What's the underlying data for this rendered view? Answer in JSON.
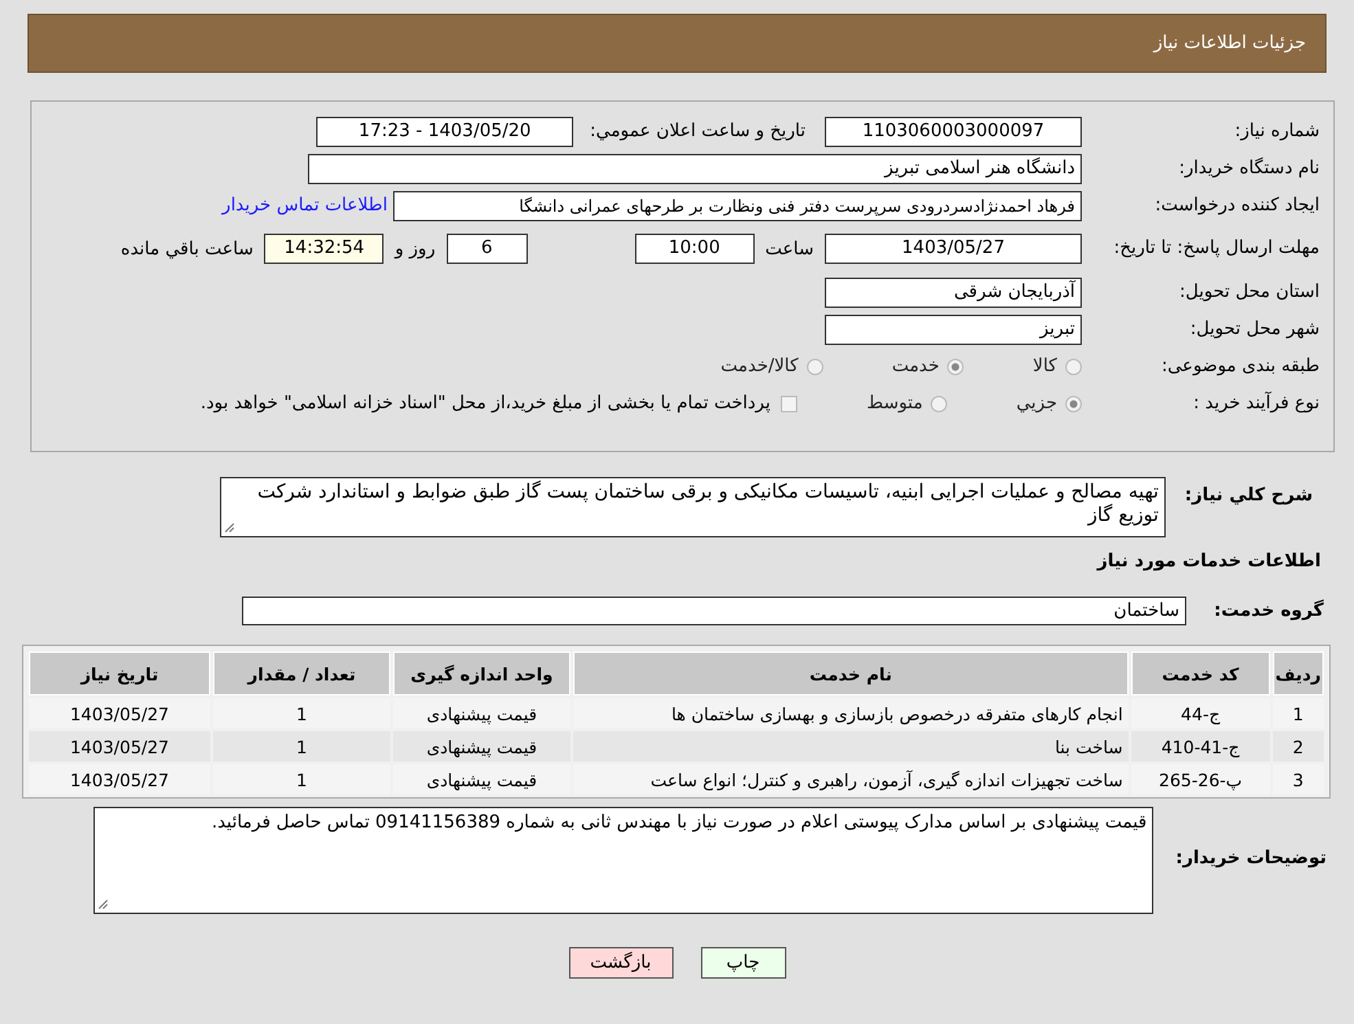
{
  "header": {
    "title": "جزئیات اطلاعات نیاز"
  },
  "need_number": {
    "label": "شماره نیاز:",
    "value": "1103060003000097"
  },
  "announce": {
    "label": "تاریخ و ساعت اعلان عمومي:",
    "value": "1403/05/20 - 17:23"
  },
  "buyer_org": {
    "label": "نام دستگاه خریدار:",
    "value": "دانشگاه هنر اسلامی تبریز"
  },
  "requester": {
    "label": "ایجاد کننده درخواست:",
    "value": "فرهاد احمدنژادسردرودی سرپرست دفتر فنی ونظارت بر طرحهای عمرانی دانشگا",
    "link": "اطلاعات تماس خریدار"
  },
  "deadline": {
    "label": "مهلت ارسال پاسخ: تا تاریخ:",
    "date": "1403/05/27",
    "time_label": "ساعت",
    "time": "10:00",
    "days": "6",
    "days_label": "روز و",
    "remaining": "14:32:54",
    "remaining_label": "ساعت باقي مانده"
  },
  "province": {
    "label": "استان محل تحویل:",
    "value": "آذربایجان شرقی"
  },
  "city": {
    "label": "شهر محل تحویل:",
    "value": "تبریز"
  },
  "category": {
    "label": "طبقه بندی موضوعی:",
    "options": [
      {
        "label": "کالا",
        "selected": false
      },
      {
        "label": "خدمت",
        "selected": true
      },
      {
        "label": "کالا/خدمت",
        "selected": false
      }
    ]
  },
  "purchase_type": {
    "label": "نوع فرآیند خرید :",
    "options": [
      {
        "label": "جزيي",
        "selected": true
      },
      {
        "label": "متوسط",
        "selected": false
      }
    ],
    "payment": {
      "label": "پرداخت تمام یا بخشی از مبلغ خرید،از محل \"اسناد خزانه اسلامی\" خواهد بود.",
      "checked": false
    }
  },
  "description": {
    "label": "شرح كلي نياز:",
    "value": "تهیه مصالح و عملیات اجرایی ابنیه، تاسیسات مکانیکی و برقی ساختمان پست گاز طبق ضوابط و استاندارد شرکت توزیع گاز"
  },
  "services_heading": "اطلاعات خدمات مورد نیاز",
  "service_group": {
    "label": "گروه خدمت:",
    "value": "ساختمان"
  },
  "table": {
    "columns": [
      "ردیف",
      "کد خدمت",
      "نام خدمت",
      "واحد اندازه گیری",
      "تعداد / مقدار",
      "تاریخ نیاز"
    ],
    "rows": [
      [
        "1",
        "ج-44",
        "انجام کارهای متفرقه درخصوص بازسازی و بهسازی ساختمان ها",
        "قیمت پیشنهادی",
        "1",
        "1403/05/27"
      ],
      [
        "2",
        "ج-41-410",
        "ساخت بنا",
        "قیمت پیشنهادی",
        "1",
        "1403/05/27"
      ],
      [
        "3",
        "پ-26-265",
        "ساخت تجهیزات اندازه گیری، آزمون، راهبری و کنترل؛ انواع ساعت",
        "قیمت پیشنهادی",
        "1",
        "1403/05/27"
      ]
    ]
  },
  "buyer_notes": {
    "label": "توضیحات خریدار:",
    "value": "قیمت پیشنهادی بر اساس مدارک پیوستی اعلام در صورت نیاز با مهندس ثانی به شماره 09141156389 تماس حاصل فرمائید."
  },
  "buttons": [
    {
      "label": "چاپ",
      "kind": "print"
    },
    {
      "label": "بازگشت",
      "kind": "back"
    }
  ]
}
